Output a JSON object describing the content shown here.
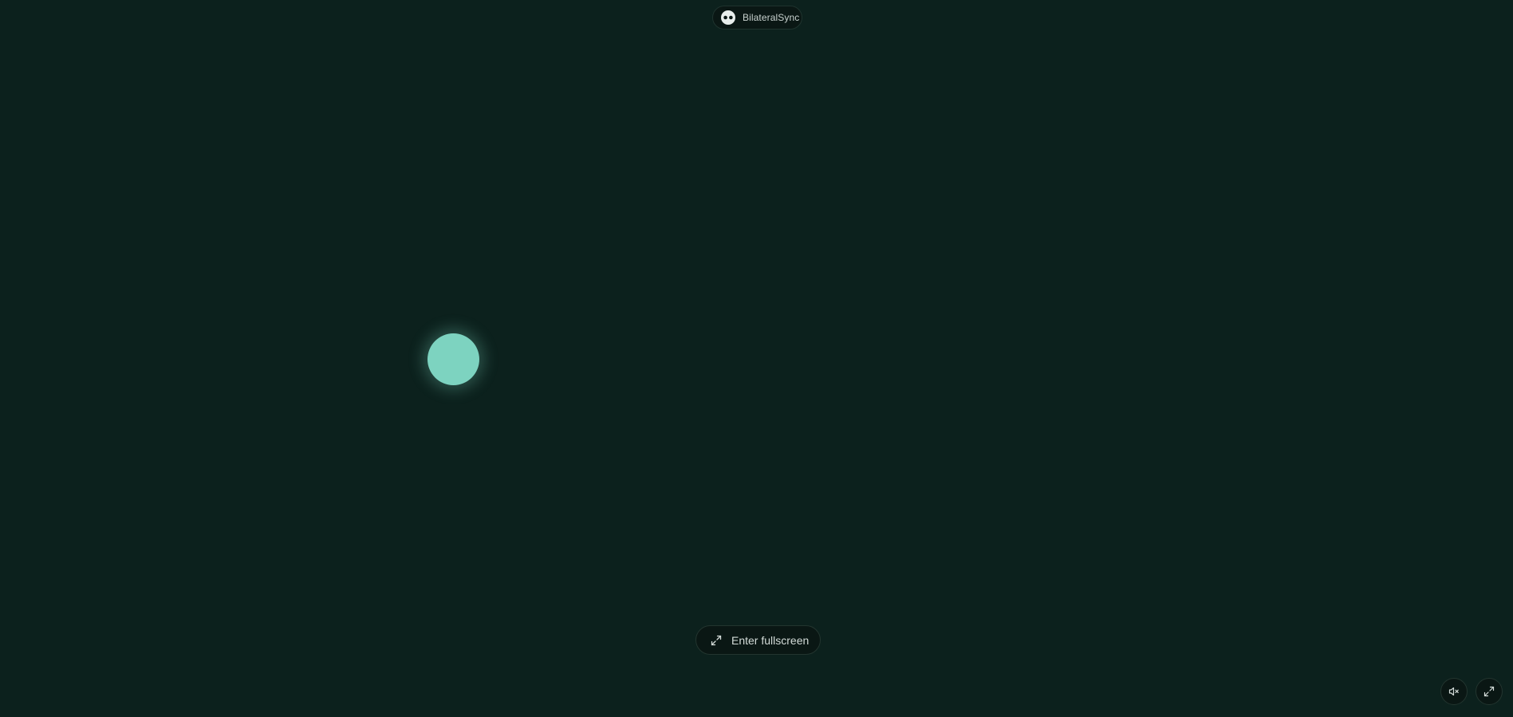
{
  "header": {
    "brand_name": "BilateralSync",
    "logo_icon": "bilateral-eyes-icon"
  },
  "stimulus": {
    "dot_color": "#7dd3c0",
    "background_color": "#0c211d"
  },
  "controls": {
    "fullscreen_label": "Enter fullscreen",
    "fullscreen_icon": "expand-arrows-icon",
    "mute_icon": "speaker-muted-icon",
    "expand_icon": "expand-arrows-icon"
  }
}
